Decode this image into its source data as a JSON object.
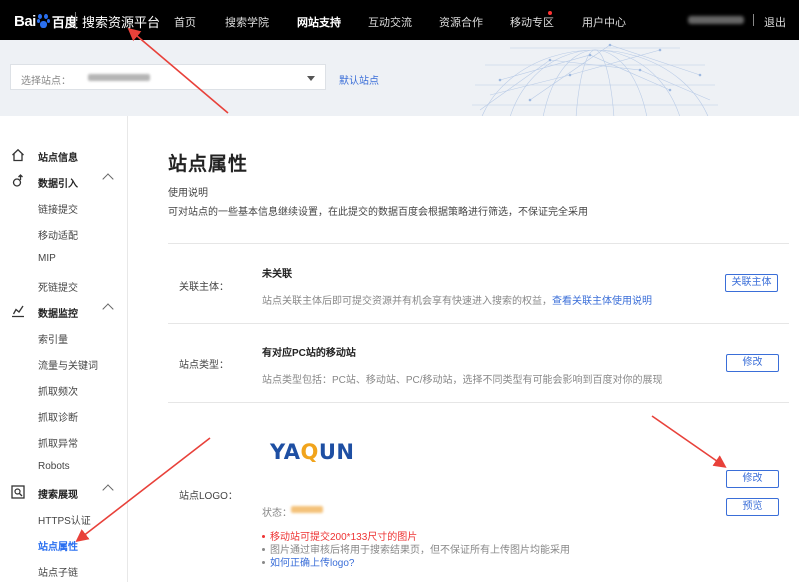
{
  "header": {
    "logo_text_bai": "Bai",
    "logo_text_cn": "百度",
    "platform_title": "搜索资源平台",
    "nav": [
      {
        "label": "首页",
        "active": false
      },
      {
        "label": "搜索学院",
        "active": false
      },
      {
        "label": "网站支持",
        "active": true
      },
      {
        "label": "互动交流",
        "active": false
      },
      {
        "label": "资源合作",
        "active": false
      },
      {
        "label": "移动专区",
        "active": false,
        "badge_dot": true
      },
      {
        "label": "用户中心",
        "active": false
      }
    ],
    "logout_label": "退出"
  },
  "site_bar": {
    "select_label": "选择站点：",
    "default_site_label": "默认站点"
  },
  "sidebar": {
    "groups": [
      {
        "label": "站点信息",
        "icon": "home-icon",
        "items": []
      },
      {
        "label": "数据引入",
        "icon": "data-import-icon",
        "items": [
          "链接提交",
          "移动适配",
          "MIP",
          "死链提交"
        ]
      },
      {
        "label": "数据监控",
        "icon": "data-monitor-icon",
        "items": [
          "索引量",
          "流量与关键词",
          "抓取频次",
          "抓取诊断",
          "抓取异常",
          "Robots"
        ]
      },
      {
        "label": "搜索展现",
        "icon": "search-display-icon",
        "items": [
          "HTTPS认证",
          "站点属性",
          "站点子链"
        ]
      }
    ],
    "active_item": "站点属性"
  },
  "main": {
    "title": "站点属性",
    "usage_title": "使用说明",
    "usage_desc": "可对站点的一些基本信息继续设置，在此提交的数据百度会根据策略进行筛选，不保证完全采用",
    "rows": {
      "subject": {
        "label": "关联主体：",
        "value": "未关联",
        "desc": "站点关联主体后即可提交资源并有机会享有快速进入搜索的权益，",
        "desc_link": "查看关联主体使用说明",
        "button": "关联主体"
      },
      "type": {
        "label": "站点类型：",
        "value": "有对应PC站的移动站",
        "desc": "站点类型包括：PC站、移动站、PC/移动站，选择不同类型有可能会影响到百度对你的展现",
        "button": "修改"
      },
      "logo": {
        "label": "站点LOGO：",
        "logo_text_left": "YA",
        "logo_text_q": "Q",
        "logo_text_right": "UN",
        "status_label": "状态：",
        "tips": [
          {
            "text": "移动站可提交200*133尺寸的图片",
            "style": "red"
          },
          {
            "text": "图片通过审核后将用于搜索结果页，但不保证所有上传图片均能采用",
            "style": "gray"
          },
          {
            "text": "如何正确上传logo?",
            "style": "link"
          }
        ],
        "edit_button": "修改",
        "preview_button": "预览"
      }
    }
  },
  "colors": {
    "accent": "#3a6ed8",
    "nav_bg": "#000000",
    "annotation_arrow": "#e8413a",
    "tip_red": "#ee3333"
  }
}
